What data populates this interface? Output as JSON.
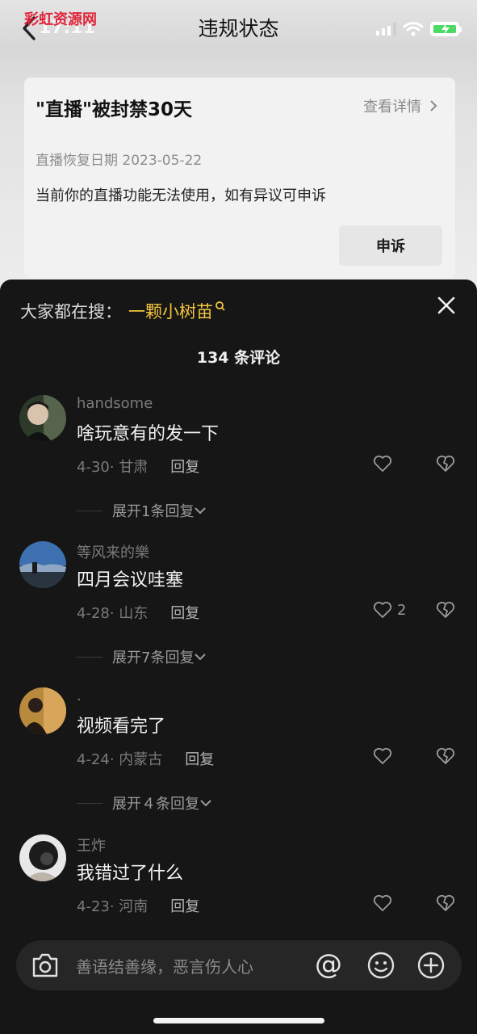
{
  "watermark": "彩虹资源网",
  "status_bar": {
    "time": "17:11"
  },
  "nav": {
    "title": "违规状态"
  },
  "ban": {
    "title": "\"直播\"被封禁30天",
    "detail_label": "查看详情",
    "restore_date": "直播恢复日期 2023-05-22",
    "description": "当前你的直播功能无法使用，如有异议可申诉",
    "appeal_label": "申诉"
  },
  "sheet": {
    "search_label": "大家都在搜：",
    "search_term": "一颗小树苗",
    "comment_count": "134 条评论"
  },
  "comments": [
    {
      "user": "handsome",
      "text": "啥玩意有的发一下",
      "meta": "4-30· 甘肃",
      "reply": "回复",
      "likes": "",
      "expand": "展开1条回复"
    },
    {
      "user": "等风来的樂",
      "text": "四月会议哇塞",
      "meta": "4-28· 山东",
      "reply": "回复",
      "likes": "2",
      "expand": "展开7条回复"
    },
    {
      "user": ".",
      "text": "视频看完了",
      "meta": "4-24· 内蒙古",
      "reply": "回复",
      "likes": "",
      "expand": "展开４条回复"
    },
    {
      "user": "王炸",
      "text": "我错过了什么",
      "meta": "4-23· 河南",
      "reply": "回复",
      "likes": "",
      "expand": ""
    }
  ],
  "input": {
    "placeholder": "善语结善缘，恶言伤人心",
    "at_symbol": "@"
  },
  "colors": {
    "accent_yellow": "#f4c53d",
    "sheet_bg": "#161616",
    "battery_green": "#4cd964"
  }
}
